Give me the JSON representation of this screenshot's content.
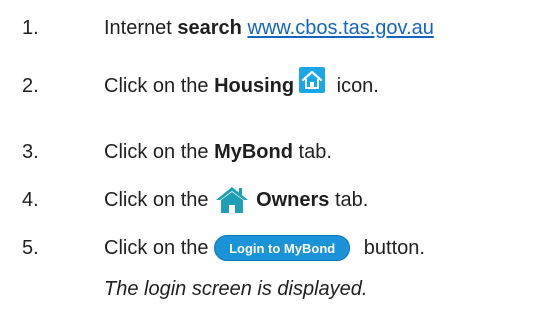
{
  "steps": [
    {
      "number": "1.",
      "prefix": "Internet ",
      "bold": "search",
      "link": "www.cbos.tas.gov.au"
    },
    {
      "number": "2.",
      "prefix": "Click on the ",
      "bold": "Housing",
      "icon": "housing-icon",
      "suffix": " icon."
    },
    {
      "number": "3.",
      "prefix": "Click on the ",
      "bold": "MyBond",
      "suffix": " tab."
    },
    {
      "number": "4.",
      "prefix": "Click on the ",
      "icon": "house-icon",
      "bold": "Owners",
      "suffix": " tab."
    },
    {
      "number": "5.",
      "prefix": "Click on the ",
      "button_label": "Login to MyBond",
      "suffix": " button."
    }
  ],
  "note": "The login screen is displayed.",
  "colors": {
    "link": "#1565c0",
    "button": "#1a93d8",
    "housing_icon": "#1aa7e8",
    "house_icon": "#1f9fb5"
  }
}
